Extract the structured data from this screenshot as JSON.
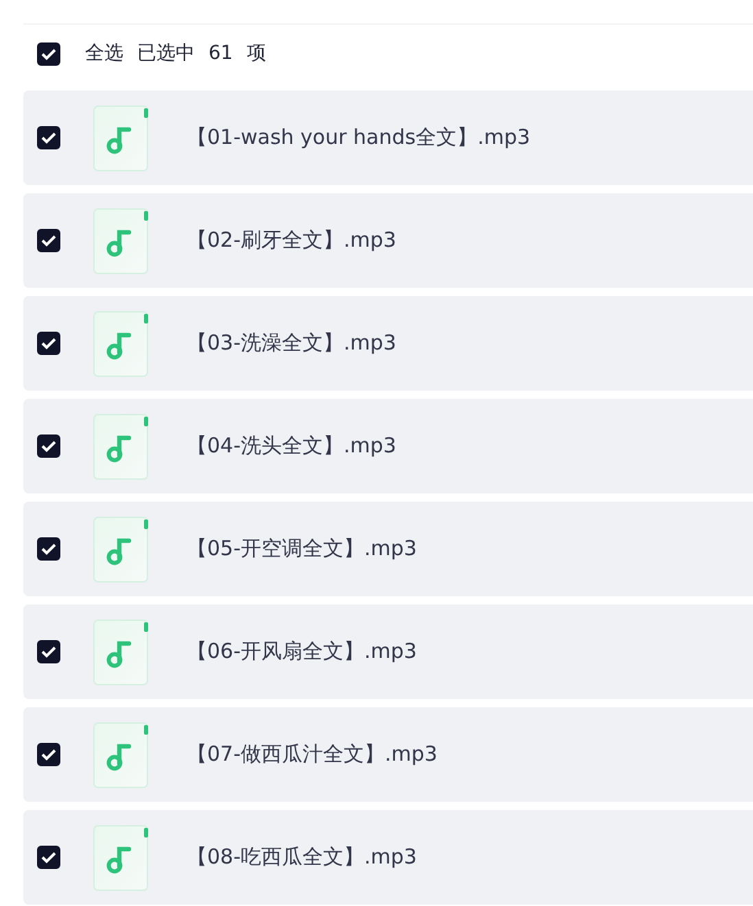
{
  "header": {
    "checked": true,
    "label": "全选",
    "selected_text": "已选中",
    "count": "61",
    "unit": "项"
  },
  "files": [
    {
      "name": "【01-wash your hands全文】.mp3",
      "checked": true
    },
    {
      "name": "【02-刷牙全文】.mp3",
      "checked": true
    },
    {
      "name": "【03-洗澡全文】.mp3",
      "checked": true
    },
    {
      "name": "【04-洗头全文】.mp3",
      "checked": true
    },
    {
      "name": "【05-开空调全文】.mp3",
      "checked": true
    },
    {
      "name": "【06-开风扇全文】.mp3",
      "checked": true
    },
    {
      "name": "【07-做西瓜汁全文】.mp3",
      "checked": true
    },
    {
      "name": "【08-吃西瓜全文】.mp3",
      "checked": true
    }
  ]
}
